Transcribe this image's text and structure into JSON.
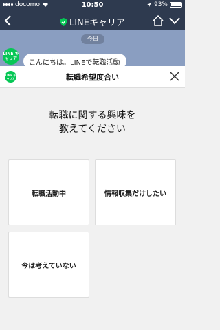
{
  "status_bar": {
    "carrier": "docomo",
    "time": "10:50",
    "battery": "93%"
  },
  "nav": {
    "title": "LINEキャリア"
  },
  "chat": {
    "date": "今日",
    "avatar_text": "LINE キャリア",
    "message": "こんにちは。LINEで転職活動"
  },
  "sheet": {
    "logo_text": "LINE キャリア",
    "title": "転職希望度合い",
    "question_line1": "転職に関する興味を",
    "question_line2": "教えてください",
    "options": [
      {
        "label": "転職活動中"
      },
      {
        "label": "情報収集だけしたい"
      },
      {
        "label": "今は考えていない"
      }
    ]
  },
  "colors": {
    "header": "#2e3a4f",
    "chat_bg": "#8a9ec1",
    "line_green": "#06c755",
    "sheet_bg": "#f1f1f1"
  }
}
